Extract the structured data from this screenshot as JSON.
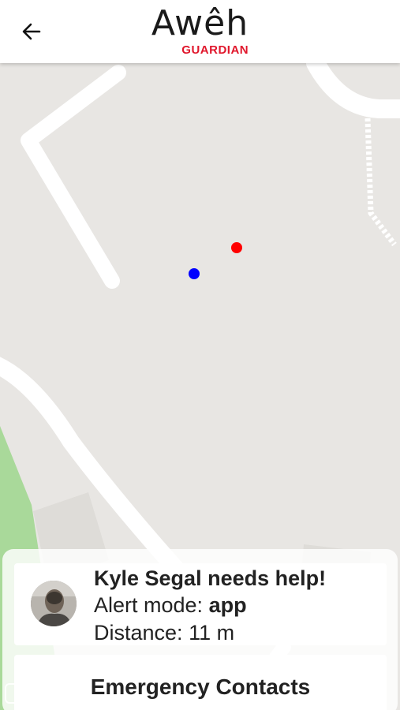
{
  "header": {
    "logo_text": "Awêh",
    "logo_subtitle": "GUARDIAN",
    "logo_subtitle_color": "#e0162b",
    "back_icon": "arrow-left-icon"
  },
  "map": {
    "markers": [
      {
        "name": "responder-location",
        "color": "#ff0000"
      },
      {
        "name": "user-location",
        "color": "#0000ff"
      }
    ],
    "colors": {
      "land": "#e8e6e3",
      "road": "#ffffff",
      "park": "#a9d99a",
      "building": "#dedcd8"
    }
  },
  "alert": {
    "title": "Kyle Segal needs help!",
    "mode_label": "Alert mode:",
    "mode_value": "app",
    "distance_label": "Distance:",
    "distance_value": "11 m"
  },
  "actions": {
    "emergency_contacts_label": "Emergency Contacts"
  }
}
